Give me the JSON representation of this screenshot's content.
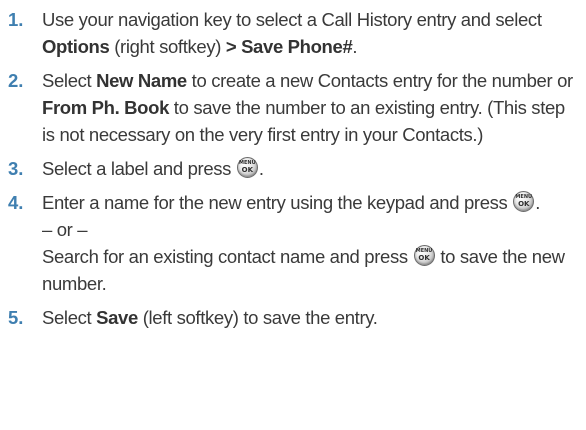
{
  "steps": [
    {
      "num": "1.",
      "t1": "Use your navigation key to select a Call History entry and select ",
      "b1": "Options",
      "t2": " (right softkey) ",
      "b2": "> Save Phone#",
      "t3": "."
    },
    {
      "num": "2.",
      "t1": "Select ",
      "b1": "New Name",
      "t2": " to create a new Contacts entry for the number or ",
      "b2": "From Ph. Book",
      "t3": " to save the number to an existing entry. (This step is not necessary on the very first entry in your Contacts.)"
    },
    {
      "num": "3.",
      "t1": "Select a label and press ",
      "t2": "."
    },
    {
      "num": "4.",
      "t1": "Enter a name for the new entry using the keypad and press ",
      "t2": ".",
      "or": "– or –",
      "t3": "Search for an existing contact name and press ",
      "t4": " to save the new number."
    },
    {
      "num": "5.",
      "t1": "Select ",
      "b1": "Save",
      "t2": " (left softkey) to save the entry."
    }
  ],
  "menu_key": {
    "icon": "menu-ok-key-icon",
    "top_label": "MENU",
    "bottom_label": "OK"
  }
}
